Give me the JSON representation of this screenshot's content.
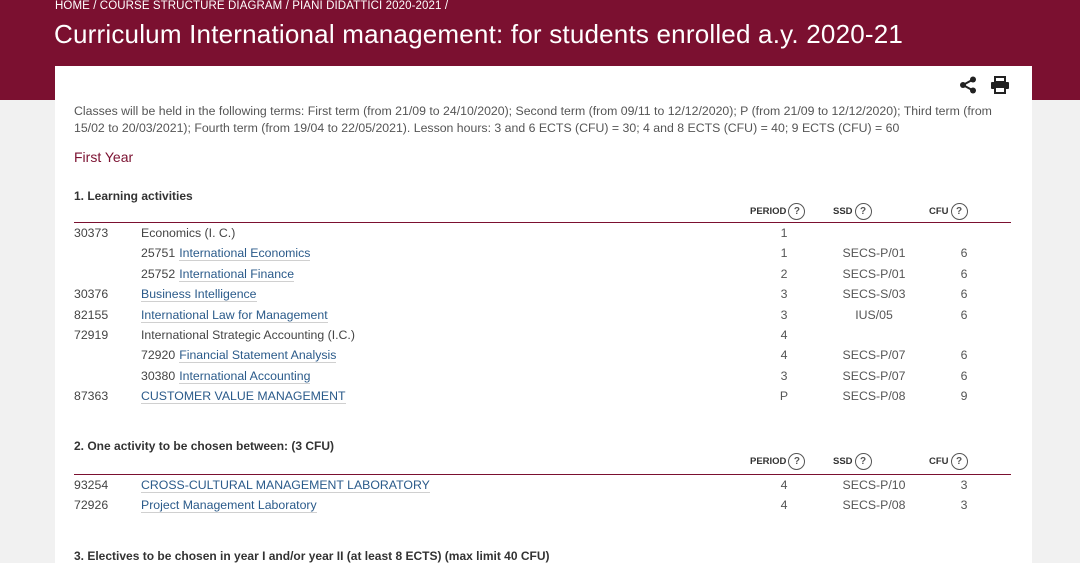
{
  "breadcrumb": "HOME / COURSE STRUCTURE DIAGRAM / PIANI DIDATTICI 2020-2021 /",
  "page_title": "Curriculum International management: for students enrolled a.y. 2020-21",
  "tools": {
    "share_icon": "share-icon",
    "print_icon": "print-icon"
  },
  "intro": "Classes will be held in the following terms: First term (from 21/09 to 24/10/2020); Second term (from 09/11 to 12/12/2020); P (from 21/09 to 12/12/2020); Third term (from 15/02 to 20/03/2021); Fourth term (from 19/04 to 22/05/2021). Lesson hours: 3 and 6 ECTS (CFU) = 30; 4 and 8 ECTS (CFU) = 40; 9 ECTS (CFU) = 60",
  "year_title": "First Year",
  "columns": {
    "period": "PERIOD",
    "ssd": "SSD",
    "cfu": "CFU",
    "help": "?"
  },
  "sections": [
    {
      "title": "1. Learning activities",
      "rows": [
        {
          "code": "30373",
          "name": "Economics (I. C.)",
          "sub": false,
          "link": false,
          "period": "1",
          "ssd": "",
          "cfu": ""
        },
        {
          "code": "25751",
          "name": "International Economics",
          "sub": true,
          "link": true,
          "period": "1",
          "ssd": "SECS-P/01",
          "cfu": "6"
        },
        {
          "code": "25752",
          "name": "International Finance",
          "sub": true,
          "link": true,
          "period": "2",
          "ssd": "SECS-P/01",
          "cfu": "6"
        },
        {
          "code": "30376",
          "name": "Business Intelligence",
          "sub": false,
          "link": true,
          "period": "3",
          "ssd": "SECS-S/03",
          "cfu": "6"
        },
        {
          "code": "82155",
          "name": "International Law for Management",
          "sub": false,
          "link": true,
          "period": "3",
          "ssd": "IUS/05",
          "cfu": "6"
        },
        {
          "code": "72919",
          "name": "International Strategic Accounting (I.C.)",
          "sub": false,
          "link": false,
          "period": "4",
          "ssd": "",
          "cfu": ""
        },
        {
          "code": "72920",
          "name": "Financial Statement Analysis",
          "sub": true,
          "link": true,
          "period": "4",
          "ssd": "SECS-P/07",
          "cfu": "6"
        },
        {
          "code": "30380",
          "name": "International Accounting",
          "sub": true,
          "link": true,
          "period": "3",
          "ssd": "SECS-P/07",
          "cfu": "6"
        },
        {
          "code": "87363",
          "name": "CUSTOMER VALUE MANAGEMENT",
          "sub": false,
          "link": true,
          "period": "P",
          "ssd": "SECS-P/08",
          "cfu": "9"
        }
      ]
    },
    {
      "title": "2. One activity to be chosen between: (3 CFU)",
      "rows": [
        {
          "code": "93254",
          "name": "CROSS-CULTURAL MANAGEMENT LABORATORY",
          "sub": false,
          "link": true,
          "period": "4",
          "ssd": "SECS-P/10",
          "cfu": "3"
        },
        {
          "code": "72926",
          "name": "Project Management Laboratory",
          "sub": false,
          "link": true,
          "period": "4",
          "ssd": "SECS-P/08",
          "cfu": "3"
        }
      ]
    },
    {
      "title": "3. Electives to be chosen in year I and/or year II (at least 8 ECTS) (max limit 40 CFU)",
      "rows": []
    }
  ]
}
